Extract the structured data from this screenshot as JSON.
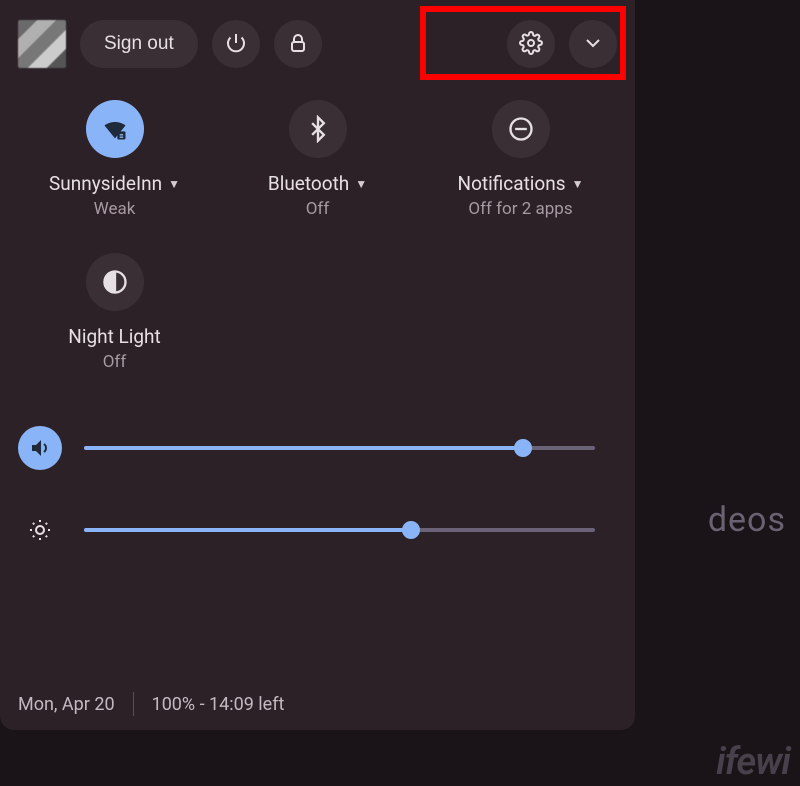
{
  "top": {
    "sign_out": "Sign out"
  },
  "tiles": {
    "wifi": {
      "label": "SunnysideInn",
      "sub": "Weak"
    },
    "bt": {
      "label": "Bluetooth",
      "sub": "Off"
    },
    "notif": {
      "label": "Notifications",
      "sub": "Off for 2 apps"
    },
    "night": {
      "label": "Night Light",
      "sub": "Off"
    }
  },
  "sliders": {
    "volume_percent": 86,
    "brightness_percent": 64
  },
  "footer": {
    "date": "Mon, Apr 20",
    "battery": "100% - 14:09 left"
  },
  "background": {
    "fragment": "deos",
    "watermark": "ifewi"
  },
  "colors": {
    "panel": "#2c2127",
    "accent": "#8ab4f8",
    "highlight": "#ff0000"
  }
}
